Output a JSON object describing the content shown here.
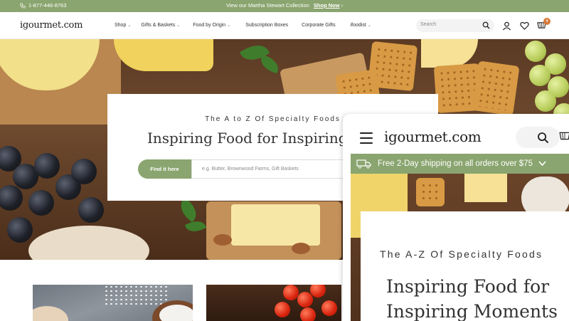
{
  "topbar": {
    "phone": "1-877-446-8763",
    "promo_text": "View our Martha Stewart Collection",
    "promo_cta": "Shop Now",
    "promo_cta_arrow": "›"
  },
  "nav": {
    "logo": "igourmet.com",
    "items": [
      {
        "label": "Shop",
        "has_dropdown": true
      },
      {
        "label": "Gifts & Baskets",
        "has_dropdown": true
      },
      {
        "label": "Food by Origin",
        "has_dropdown": true
      },
      {
        "label": "Subscription Boxes",
        "has_dropdown": false
      },
      {
        "label": "Corporate Gifts",
        "has_dropdown": false
      },
      {
        "label": "ifoodist",
        "has_dropdown": true
      }
    ],
    "search_placeholder": "Search",
    "cart_count": "4",
    "icons": [
      "search-icon",
      "account-icon",
      "heart-icon",
      "cart-icon"
    ]
  },
  "hero": {
    "kicker": "The A to Z Of Specialty Foods",
    "headline": "Inspiring Food for Inspiring Moments",
    "find_button": "Find it here",
    "find_placeholder": "e.g. Butter, Brownwood Farms, Gift Baskets"
  },
  "mobile": {
    "logo": "igourmet.com",
    "shipping": "Free 2-Day shipping on all orders over $75",
    "kicker": "The A-Z Of Specialty Foods",
    "headline": "Inspiring Food for Inspiring Moments"
  },
  "colors": {
    "accent_green": "#8aa56f",
    "cart_badge": "#d57b3d"
  }
}
